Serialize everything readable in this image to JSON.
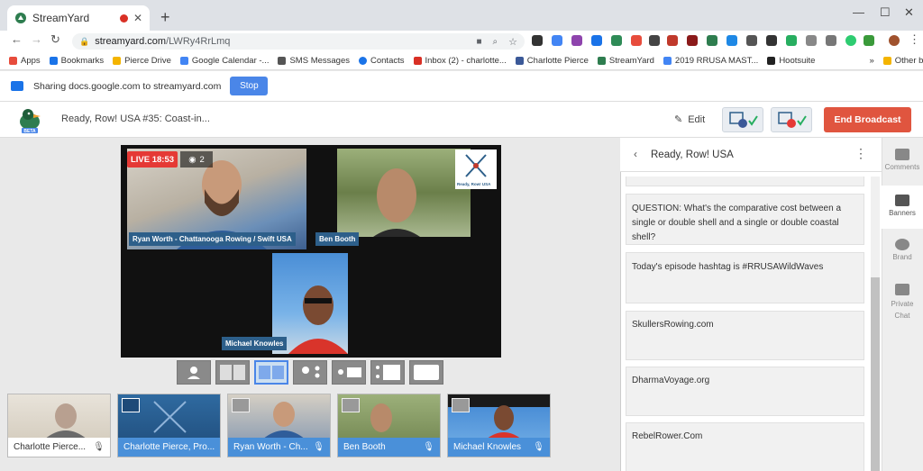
{
  "browser": {
    "tab_title": "StreamYard",
    "url_host": "streamyard.com",
    "url_path": "/LWRy4RrLmq",
    "bookmarks": [
      "Apps",
      "Bookmarks",
      "Pierce Drive",
      "Google Calendar -...",
      "SMS Messages",
      "Contacts",
      "Inbox (2) - charlotte...",
      "Charlotte Pierce",
      "StreamYard",
      "2019 RRUSA MAST...",
      "Hootsuite"
    ],
    "bookmarks_more": "»",
    "other_bookmarks": "Other bookmarks"
  },
  "sharing_bar": {
    "text": "Sharing docs.google.com to streamyard.com",
    "stop_label": "Stop"
  },
  "header": {
    "show_title": "Ready, Row! USA #35: Coast-in...",
    "edit_label": "Edit",
    "end_label": "End Broadcast"
  },
  "stage": {
    "live_label": "LIVE 18:53",
    "viewer_count": "2",
    "logo_text": "Ready, Row! USA",
    "participants": [
      {
        "name": "Ryan Worth - Chattanooga Rowing / Swift USA"
      },
      {
        "name": "Ben Booth"
      },
      {
        "name": "Michael Knowles"
      }
    ]
  },
  "participants_row": [
    {
      "label": "Charlotte Pierce...",
      "bar_color": "#ffffff",
      "text_color": "#333333"
    },
    {
      "label": "Charlotte Pierce, Pro...",
      "bar_color": "#4a90d9",
      "text_color": "#ffffff"
    },
    {
      "label": "Ryan Worth - Ch...",
      "bar_color": "#4a90d9",
      "text_color": "#ffffff"
    },
    {
      "label": "Ben Booth",
      "bar_color": "#4a90d9",
      "text_color": "#ffffff"
    },
    {
      "label": "Michael Knowles",
      "bar_color": "#4a90d9",
      "text_color": "#ffffff"
    }
  ],
  "panel": {
    "title": "Ready, Row! USA",
    "banners": [
      "QUESTION: What's the comparative cost between a single or double shell and a single or double coastal shell?",
      "Today's episode hashtag is #RRUSAWildWaves",
      "SkullersRowing.com",
      "DharmaVoyage.org",
      "RebelRower.Com"
    ]
  },
  "sidebar": {
    "items": [
      "Comments",
      "Banners",
      "Brand",
      "Private Chat"
    ],
    "active": "Banners"
  },
  "colors": {
    "accent": "#4a86e8",
    "live": "#e53935",
    "end_broadcast": "#e0553f",
    "name_bar": "#2d5f8a"
  }
}
